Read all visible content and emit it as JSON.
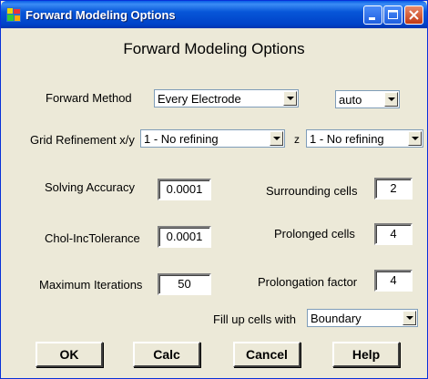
{
  "window": {
    "title": "Forward Modeling Options"
  },
  "heading": "Forward Modeling Options",
  "forward_method": {
    "label": "Forward Method",
    "value": "Every Electrode",
    "mode_value": "auto"
  },
  "grid_refinement": {
    "label": "Grid Refinement x/y",
    "xy_value": "1 - No refining",
    "z_label": "z",
    "z_value": "1 - No refining"
  },
  "solving_accuracy": {
    "label": "Solving Accuracy",
    "value": "0.0001"
  },
  "chol_tolerance": {
    "label": "Chol-IncTolerance",
    "value": "0.0001"
  },
  "max_iterations": {
    "label": "Maximum Iterations",
    "value": "50"
  },
  "surrounding_cells": {
    "label": "Surrounding cells",
    "value": "2"
  },
  "prolonged_cells": {
    "label": "Prolonged cells",
    "value": "4"
  },
  "prolongation_factor": {
    "label": "Prolongation factor",
    "value": "4"
  },
  "fill_up": {
    "label": "Fill up cells with",
    "value": "Boundary"
  },
  "buttons": {
    "ok": "OK",
    "calc": "Calc",
    "cancel": "Cancel",
    "help": "Help"
  }
}
